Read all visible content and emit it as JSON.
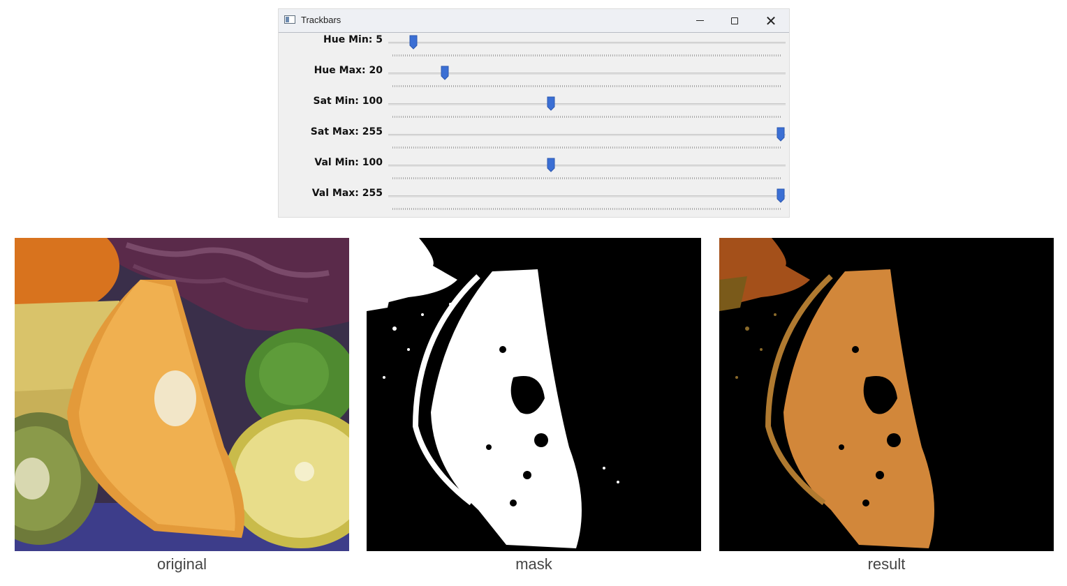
{
  "window": {
    "title": "Trackbars",
    "icon": "app-window-icon",
    "controls": [
      "minimize-icon",
      "maximize-icon",
      "close-icon"
    ]
  },
  "trackbars": [
    {
      "label": "Hue Min: 5",
      "value": 5,
      "max": 179
    },
    {
      "label": "Hue Max: 20",
      "value": 20,
      "max": 179
    },
    {
      "label": "Sat Min: 100",
      "value": 100,
      "max": 255
    },
    {
      "label": "Sat Max: 255",
      "value": 255,
      "max": 255
    },
    {
      "label": "Val Min: 100",
      "value": 100,
      "max": 255
    },
    {
      "label": "Val Max: 255",
      "value": 255,
      "max": 255
    }
  ],
  "thumb_color": "#3b6fd4",
  "images": [
    {
      "caption": "original"
    },
    {
      "caption": "mask"
    },
    {
      "caption": "result"
    }
  ]
}
